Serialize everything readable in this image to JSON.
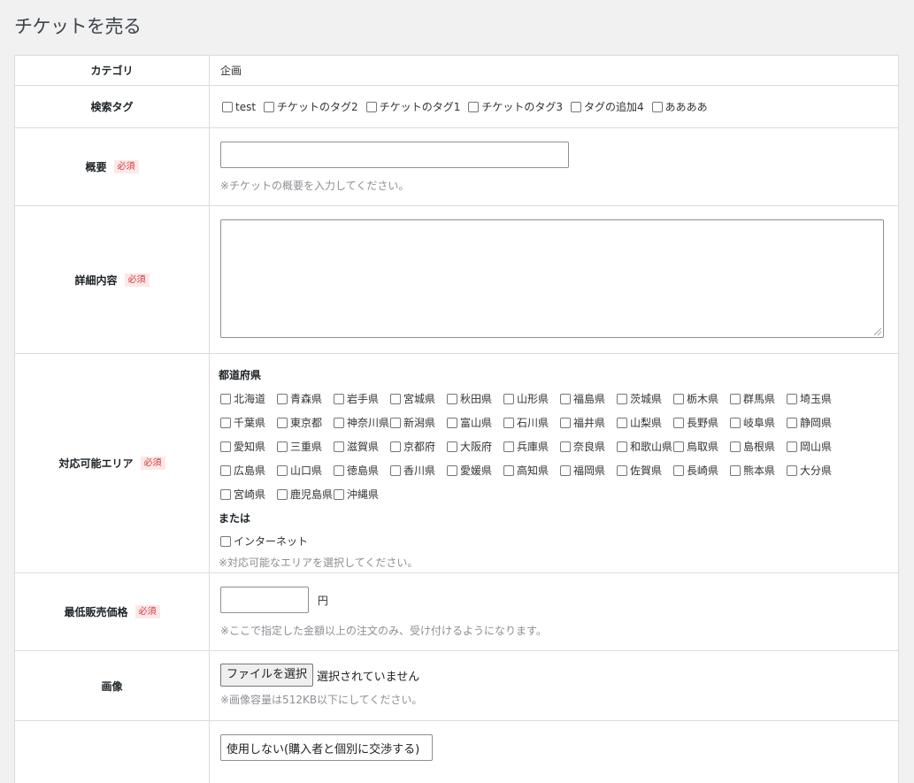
{
  "page": {
    "title": "チケットを売る"
  },
  "required_badge": "必須",
  "category": {
    "label": "カテゴリ",
    "value": "企画"
  },
  "tags": {
    "label": "検索タグ",
    "options": [
      "test",
      "チケットのタグ2",
      "チケットのタグ1",
      "チケットのタグ3",
      "タグの追加4",
      "ああああ"
    ]
  },
  "summary": {
    "label": "概要",
    "hint": "※チケットの概要を入力してください。"
  },
  "details": {
    "label": "詳細内容"
  },
  "area": {
    "label": "対応可能エリア",
    "prefectures_heading": "都道府県",
    "prefectures": [
      "北海道",
      "青森県",
      "岩手県",
      "宮城県",
      "秋田県",
      "山形県",
      "福島県",
      "茨城県",
      "栃木県",
      "群馬県",
      "埼玉県",
      "千葉県",
      "東京都",
      "神奈川県",
      "新潟県",
      "富山県",
      "石川県",
      "福井県",
      "山梨県",
      "長野県",
      "岐阜県",
      "静岡県",
      "愛知県",
      "三重県",
      "滋賀県",
      "京都府",
      "大阪府",
      "兵庫県",
      "奈良県",
      "和歌山県",
      "鳥取県",
      "島根県",
      "岡山県",
      "広島県",
      "山口県",
      "徳島県",
      "香川県",
      "愛媛県",
      "高知県",
      "福岡県",
      "佐賀県",
      "長崎県",
      "熊本県",
      "大分県",
      "宮崎県",
      "鹿児島県",
      "沖縄県"
    ],
    "or_label": "または",
    "internet": "インターネット",
    "hint": "※対応可能なエリアを選択してください。"
  },
  "price": {
    "label": "最低販売価格",
    "unit": "円",
    "hint": "※ここで指定した金額以上の注文のみ、受け付けるようになります。"
  },
  "image": {
    "label": "画像",
    "button": "ファイルを選択",
    "status": "選択されていません",
    "hint": "※画像容量は512KB以下にしてください。"
  },
  "negotiation": {
    "selected": "使用しない(購入者と個別に交渉する)"
  }
}
